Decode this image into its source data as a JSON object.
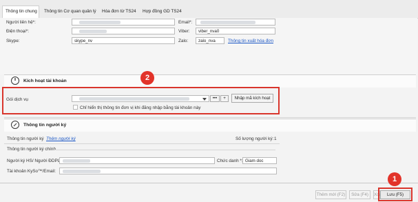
{
  "tabs": [
    {
      "label": "Thông tin chung"
    },
    {
      "label": "Thông tin Cơ quan quản lý"
    },
    {
      "label": "Hóa đơn từ TS24"
    },
    {
      "label": "Hợp đồng GD TS24"
    }
  ],
  "contact": {
    "nguoi_lien_he_label": "Người liên hệ*:",
    "email_label": "Email*:",
    "dien_thoai_label": "Điện thoại*:",
    "viber_label": "Viber:",
    "viber_value": "viber_nva0",
    "skype_label": "Skype:",
    "skype_value": "skype_nv",
    "zalo_label": "Zalo:",
    "zalo_value": "zalo_nva",
    "invoice_link": "Thông tin xuất hóa đơn"
  },
  "activation": {
    "title": "Kích hoạt tài khoản",
    "goi_dich_vu_label": "Gói dịch vụ",
    "more_label": "•••",
    "add_label": "+",
    "enter_code_button": "Nhập mã kích hoạt",
    "checkbox_label": "Chỉ hiển thị thông tin đơn vị khi đăng nhập bằng tài khoản này"
  },
  "signer": {
    "title": "Thông tin người ký",
    "subheader_label": "Thông tin người ký",
    "add_link": "Thêm người ký",
    "count_label": "Số lượng người ký:",
    "count_value": "1",
    "main_label": "Thông tin người ký chính",
    "nguoi_ky_label": "Người ký HS/ Người ĐDPL*:",
    "chuc_danh_label": "Chức danh *:",
    "chuc_danh_value": "Giam doc",
    "kyso_label": "Tài khoản KySo™/Email:"
  },
  "footer": {
    "add_new": "Thêm mới (F2)",
    "edit": "Sửa (F4)",
    "delete": "Xóa",
    "save": "Lưu (F5)"
  },
  "badges": {
    "one": "1",
    "two": "2"
  },
  "colors": {
    "annotation_red": "#d9352c",
    "link_blue": "#1a56c5"
  }
}
